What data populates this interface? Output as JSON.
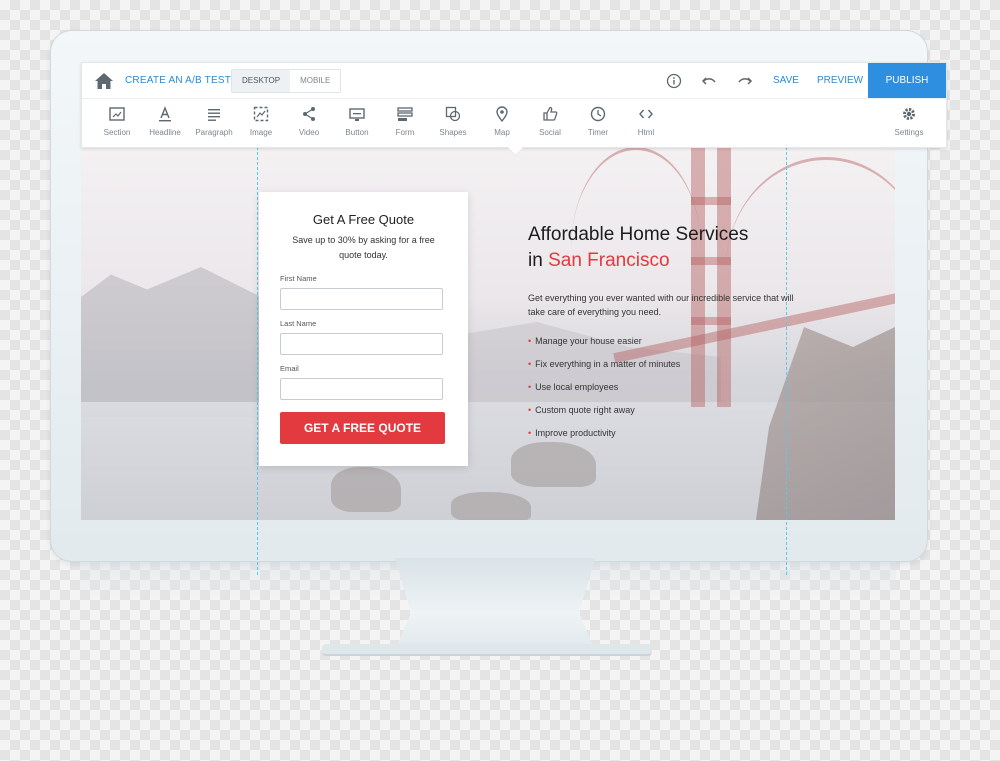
{
  "topbar": {
    "ab_test_label": "CREATE AN A/B TEST",
    "view_modes": [
      "DESKTOP",
      "MOBILE"
    ],
    "active_view": "DESKTOP",
    "save_label": "SAVE",
    "preview_label": "PREVIEW",
    "publish_label": "PUBLISH"
  },
  "tools": [
    {
      "label": "Section",
      "icon": "section-icon"
    },
    {
      "label": "Headline",
      "icon": "headline-icon"
    },
    {
      "label": "Paragraph",
      "icon": "paragraph-icon"
    },
    {
      "label": "Image",
      "icon": "image-icon"
    },
    {
      "label": "Video",
      "icon": "share-icon"
    },
    {
      "label": "Button",
      "icon": "button-icon"
    },
    {
      "label": "Form",
      "icon": "form-icon"
    },
    {
      "label": "Shapes",
      "icon": "shapes-icon"
    },
    {
      "label": "Map",
      "icon": "map-pin-icon"
    },
    {
      "label": "Social",
      "icon": "thumbs-up-icon"
    },
    {
      "label": "Timer",
      "icon": "clock-icon"
    },
    {
      "label": "Html",
      "icon": "code-icon"
    }
  ],
  "settings_label": "Settings",
  "form": {
    "title": "Get A Free Quote",
    "subtitle": "Save up to 30% by asking for a free quote today.",
    "fields": [
      {
        "label": "First Name",
        "value": ""
      },
      {
        "label": "Last Name",
        "value": ""
      },
      {
        "label": "Email",
        "value": ""
      }
    ],
    "cta_label": "GET A FREE QUOTE"
  },
  "hero": {
    "title_line1": "Affordable Home Services",
    "title_in": "in ",
    "title_city": "San Francisco",
    "description": "Get everything you ever wanted with our incredible service that will take care of everything you need.",
    "bullets": [
      "Manage your house easier",
      "Fix everything in a matter of minutes",
      "Use local employees",
      "Custom quote right away",
      "Improve productivity"
    ]
  },
  "colors": {
    "accent_blue": "#2e8ee0",
    "accent_red": "#e23a3f"
  }
}
